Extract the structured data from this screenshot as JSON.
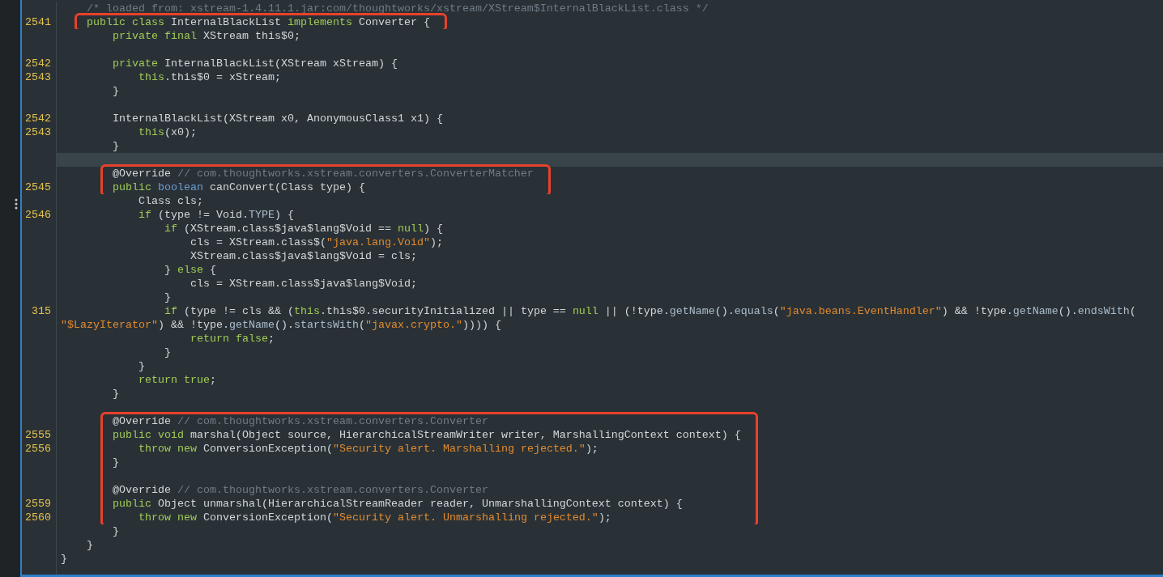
{
  "editor": {
    "blocks": [
      {
        "highlighted": false,
        "lines": [
          {
            "current": false,
            "tokens": [
              {
                "kind": "comment",
                "text": "    /* loaded from: xstream-1.4.11.1.jar:com/thoughtworks/xstream/XStream$InternalBlackList.class */"
              }
            ]
          }
        ]
      },
      {
        "highlighted": true,
        "lines": [
          {
            "number": "2541",
            "current": false,
            "tokens": [
              {
                "kind": "keyword",
                "text": "    public class"
              },
              {
                "kind": "plain",
                "text": " InternalBlackList "
              },
              {
                "kind": "keyword",
                "text": "implements"
              },
              {
                "kind": "plain",
                "text": " Converter {"
              }
            ]
          }
        ]
      },
      {
        "highlighted": false,
        "lines": [
          {
            "current": false,
            "tokens": [
              {
                "kind": "keyword",
                "text": "        private final"
              },
              {
                "kind": "plain",
                "text": " XStream this$0;"
              }
            ]
          },
          {
            "current": false
          },
          {
            "number": "2542",
            "current": false,
            "tokens": [
              {
                "kind": "keyword",
                "text": "        private"
              },
              {
                "kind": "plain",
                "text": " InternalBlackList(XStream xStream) {"
              }
            ]
          },
          {
            "number": "2543",
            "current": false,
            "tokens": [
              {
                "kind": "keyword",
                "text": "            this"
              },
              {
                "kind": "plain",
                "text": ".this$0 = xStream;"
              }
            ]
          },
          {
            "current": false,
            "tokens": [
              {
                "kind": "plain",
                "text": "        }"
              }
            ]
          },
          {
            "current": false
          },
          {
            "number": "2542",
            "current": false,
            "tokens": [
              {
                "kind": "plain",
                "text": "        InternalBlackList(XStream x0, AnonymousClass1 x1) {"
              }
            ]
          },
          {
            "number": "2543",
            "current": false,
            "tokens": [
              {
                "kind": "keyword",
                "text": "            this"
              },
              {
                "kind": "plain",
                "text": "(x0);"
              }
            ]
          },
          {
            "current": false,
            "tokens": [
              {
                "kind": "plain",
                "text": "        }"
              }
            ]
          },
          {
            "current": true
          }
        ]
      },
      {
        "highlighted": true,
        "lines": [
          {
            "current": false,
            "tokens": [
              {
                "kind": "plain",
                "text": "        @Override "
              },
              {
                "kind": "comment",
                "text": "// com.thoughtworks.xstream.converters.ConverterMatcher"
              }
            ]
          },
          {
            "number": "2545",
            "current": false,
            "tokens": [
              {
                "kind": "keyword",
                "text": "        public "
              },
              {
                "kind": "type",
                "text": "boolean"
              },
              {
                "kind": "plain",
                "text": " canConvert(Class type) {"
              }
            ]
          }
        ]
      },
      {
        "highlighted": false,
        "lines": [
          {
            "current": false,
            "tokens": [
              {
                "kind": "plain",
                "text": "            Class cls;"
              }
            ]
          },
          {
            "number": "2546",
            "current": false,
            "tokens": [
              {
                "kind": "keyword",
                "text": "            if"
              },
              {
                "kind": "plain",
                "text": " (type != Void."
              },
              {
                "kind": "member",
                "text": "TYPE"
              },
              {
                "kind": "plain",
                "text": ") {"
              }
            ]
          },
          {
            "current": false,
            "tokens": [
              {
                "kind": "keyword",
                "text": "                if"
              },
              {
                "kind": "plain",
                "text": " (XStream.class$java$lang$Void == "
              },
              {
                "kind": "keyword",
                "text": "null"
              },
              {
                "kind": "plain",
                "text": ") {"
              }
            ]
          },
          {
            "current": false,
            "tokens": [
              {
                "kind": "plain",
                "text": "                    cls = XStream.class$("
              },
              {
                "kind": "string",
                "text": "\"java.lang.Void\""
              },
              {
                "kind": "plain",
                "text": ");"
              }
            ]
          },
          {
            "current": false,
            "tokens": [
              {
                "kind": "plain",
                "text": "                    XStream.class$java$lang$Void = cls;"
              }
            ]
          },
          {
            "current": false,
            "tokens": [
              {
                "kind": "plain",
                "text": "                } "
              },
              {
                "kind": "keyword",
                "text": "else"
              },
              {
                "kind": "plain",
                "text": " {"
              }
            ]
          },
          {
            "current": false,
            "tokens": [
              {
                "kind": "plain",
                "text": "                    cls = XStream.class$java$lang$Void;"
              }
            ]
          },
          {
            "current": false,
            "tokens": [
              {
                "kind": "plain",
                "text": "                }"
              }
            ]
          },
          {
            "number": "315",
            "current": false,
            "tokens": [
              {
                "kind": "keyword",
                "text": "                if"
              },
              {
                "kind": "plain",
                "text": " (type != cls && ("
              },
              {
                "kind": "keyword",
                "text": "this"
              },
              {
                "kind": "plain",
                "text": ".this$0.securityInitialized || type == "
              },
              {
                "kind": "keyword",
                "text": "null"
              },
              {
                "kind": "plain",
                "text": " || (!type."
              },
              {
                "kind": "member",
                "text": "getName"
              },
              {
                "kind": "plain",
                "text": "()."
              },
              {
                "kind": "member",
                "text": "equals"
              },
              {
                "kind": "plain",
                "text": "("
              },
              {
                "kind": "string",
                "text": "\"java.beans.EventHandler\""
              },
              {
                "kind": "plain",
                "text": ") && !type."
              },
              {
                "kind": "member",
                "text": "getName"
              },
              {
                "kind": "plain",
                "text": "()."
              },
              {
                "kind": "member",
                "text": "endsWith"
              },
              {
                "kind": "plain",
                "text": "("
              }
            ]
          },
          {
            "current": false,
            "tokens": [
              {
                "kind": "string",
                "text": "\"$LazyIterator\""
              },
              {
                "kind": "plain",
                "text": ") && !type."
              },
              {
                "kind": "member",
                "text": "getName"
              },
              {
                "kind": "plain",
                "text": "()."
              },
              {
                "kind": "member",
                "text": "startsWith"
              },
              {
                "kind": "plain",
                "text": "("
              },
              {
                "kind": "string",
                "text": "\"javax.crypto.\""
              },
              {
                "kind": "plain",
                "text": ")))) {"
              }
            ]
          },
          {
            "current": false,
            "tokens": [
              {
                "kind": "keyword",
                "text": "                    return false"
              },
              {
                "kind": "plain",
                "text": ";"
              }
            ]
          },
          {
            "current": false,
            "tokens": [
              {
                "kind": "plain",
                "text": "                }"
              }
            ]
          },
          {
            "current": false,
            "tokens": [
              {
                "kind": "plain",
                "text": "            }"
              }
            ]
          },
          {
            "current": false,
            "tokens": [
              {
                "kind": "keyword",
                "text": "            return true"
              },
              {
                "kind": "plain",
                "text": ";"
              }
            ]
          },
          {
            "current": false,
            "tokens": [
              {
                "kind": "plain",
                "text": "        }"
              }
            ]
          },
          {
            "current": false
          }
        ]
      },
      {
        "highlighted": true,
        "lines": [
          {
            "current": false,
            "tokens": [
              {
                "kind": "plain",
                "text": "        @Override "
              },
              {
                "kind": "comment",
                "text": "// com.thoughtworks.xstream.converters.Converter"
              }
            ]
          },
          {
            "number": "2555",
            "current": false,
            "tokens": [
              {
                "kind": "keyword",
                "text": "        public void"
              },
              {
                "kind": "plain",
                "text": " marshal(Object source, HierarchicalStreamWriter writer, MarshallingContext context) {"
              }
            ]
          },
          {
            "number": "2556",
            "current": false,
            "tokens": [
              {
                "kind": "keyword",
                "text": "            throw new"
              },
              {
                "kind": "plain",
                "text": " ConversionException("
              },
              {
                "kind": "string",
                "text": "\"Security alert. Marshalling rejected.\""
              },
              {
                "kind": "plain",
                "text": ");"
              }
            ]
          },
          {
            "current": false,
            "tokens": [
              {
                "kind": "plain",
                "text": "        }"
              }
            ]
          },
          {
            "current": false
          },
          {
            "current": false,
            "tokens": [
              {
                "kind": "plain",
                "text": "        @Override "
              },
              {
                "kind": "comment",
                "text": "// com.thoughtworks.xstream.converters.Converter"
              }
            ]
          },
          {
            "number": "2559",
            "current": false,
            "tokens": [
              {
                "kind": "keyword",
                "text": "        public"
              },
              {
                "kind": "plain",
                "text": " Object unmarshal(HierarchicalStreamReader reader, UnmarshallingContext context) {"
              }
            ]
          },
          {
            "number": "2560",
            "current": false,
            "tokens": [
              {
                "kind": "keyword",
                "text": "            throw new"
              },
              {
                "kind": "plain",
                "text": " ConversionException("
              },
              {
                "kind": "string",
                "text": "\"Security alert. Unmarshalling rejected.\""
              },
              {
                "kind": "plain",
                "text": ");"
              }
            ]
          }
        ]
      },
      {
        "highlighted": false,
        "lines": [
          {
            "current": false,
            "tokens": [
              {
                "kind": "plain",
                "text": "        }"
              }
            ]
          },
          {
            "current": false,
            "tokens": [
              {
                "kind": "plain",
                "text": "    }"
              }
            ]
          },
          {
            "current": false,
            "tokens": [
              {
                "kind": "plain",
                "text": "}"
              }
            ]
          }
        ]
      }
    ]
  }
}
